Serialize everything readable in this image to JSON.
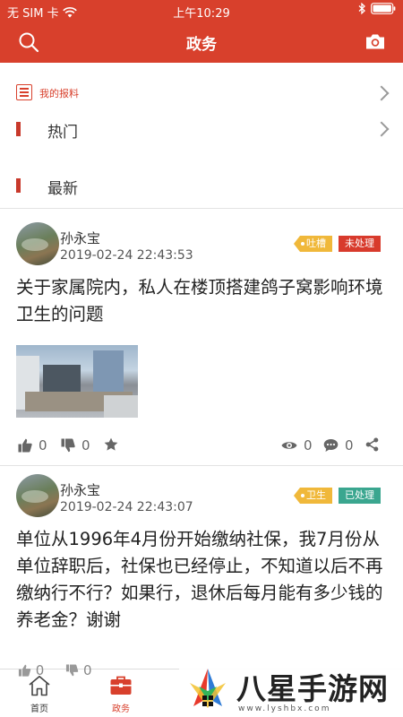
{
  "status_bar": {
    "carrier": "无 SIM 卡",
    "time": "上午10:29"
  },
  "nav": {
    "title": "政务"
  },
  "sections": {
    "my_reports": "我的报料",
    "hot": "热门",
    "latest": "最新"
  },
  "colors": {
    "brand": "#d8402c",
    "tag_yellow": "#f0b83a",
    "tag_red": "#d83a2c",
    "tag_green": "#3aa68f"
  },
  "posts": [
    {
      "author": "孙永宝",
      "time": "2019-02-24 22:43:53",
      "category": "吐槽",
      "status": "未处理",
      "text": "关于家属院内，私人在楼顶搭建鸽子窝影响环境卫生的问题",
      "likes": "0",
      "dislikes": "0",
      "views": "0",
      "comments": "0"
    },
    {
      "author": "孙永宝",
      "time": "2019-02-24 22:43:07",
      "category": "卫生",
      "status": "已处理",
      "text": "单位从1996年4月份开始缴纳社保，我7月份从单位辞职后，社保也已经停止，不知道以后不再缴纳行不行？如果行，退休后每月能有多少钱的养老金？谢谢",
      "likes": "0",
      "dislikes": "0"
    }
  ],
  "tabs": {
    "home": "首页",
    "gov": "政务"
  },
  "watermark": {
    "brand": "八星手游网",
    "url": "www.lyshbx.com"
  }
}
